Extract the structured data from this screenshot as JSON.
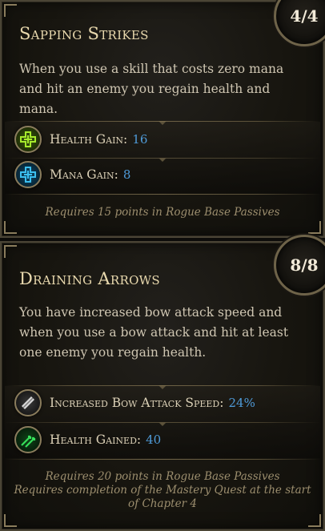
{
  "nodes": [
    {
      "title": "Sapping Strikes",
      "rank": "4/4",
      "description": "When you use a skill that costs zero mana and hit an enemy you regain health and mana.",
      "stats": [
        {
          "icon": "health-gain-icon",
          "label": "Health Gain:",
          "value": "16",
          "icon_color": "#9be02a"
        },
        {
          "icon": "mana-gain-icon",
          "label": "Mana Gain:",
          "value": "8",
          "icon_color": "#37b6e8"
        }
      ],
      "requirements": [
        "Requires 15 points in Rogue Base Passives"
      ]
    },
    {
      "title": "Draining Arrows",
      "rank": "8/8",
      "description": "You have increased bow attack speed and when you use a bow attack and hit at least one enemy you regain health.",
      "stats": [
        {
          "icon": "bow-attack-speed-icon",
          "label": "Increased Bow Attack Speed:",
          "value": "24%",
          "icon_color": "#cfcfcf"
        },
        {
          "icon": "health-gained-icon",
          "label": "Health Gained:",
          "value": "40",
          "icon_color": "#2fd14a"
        }
      ],
      "requirements": [
        "Requires 20 points in Rogue Base Passives",
        "Requires completion of the Mastery Quest at the start of Chapter 4"
      ]
    }
  ],
  "colors": {
    "title": "#e9d9ae",
    "stat_value": "#4f9bd9",
    "requirement": "#9c8e6e",
    "border": "#4a4435"
  }
}
